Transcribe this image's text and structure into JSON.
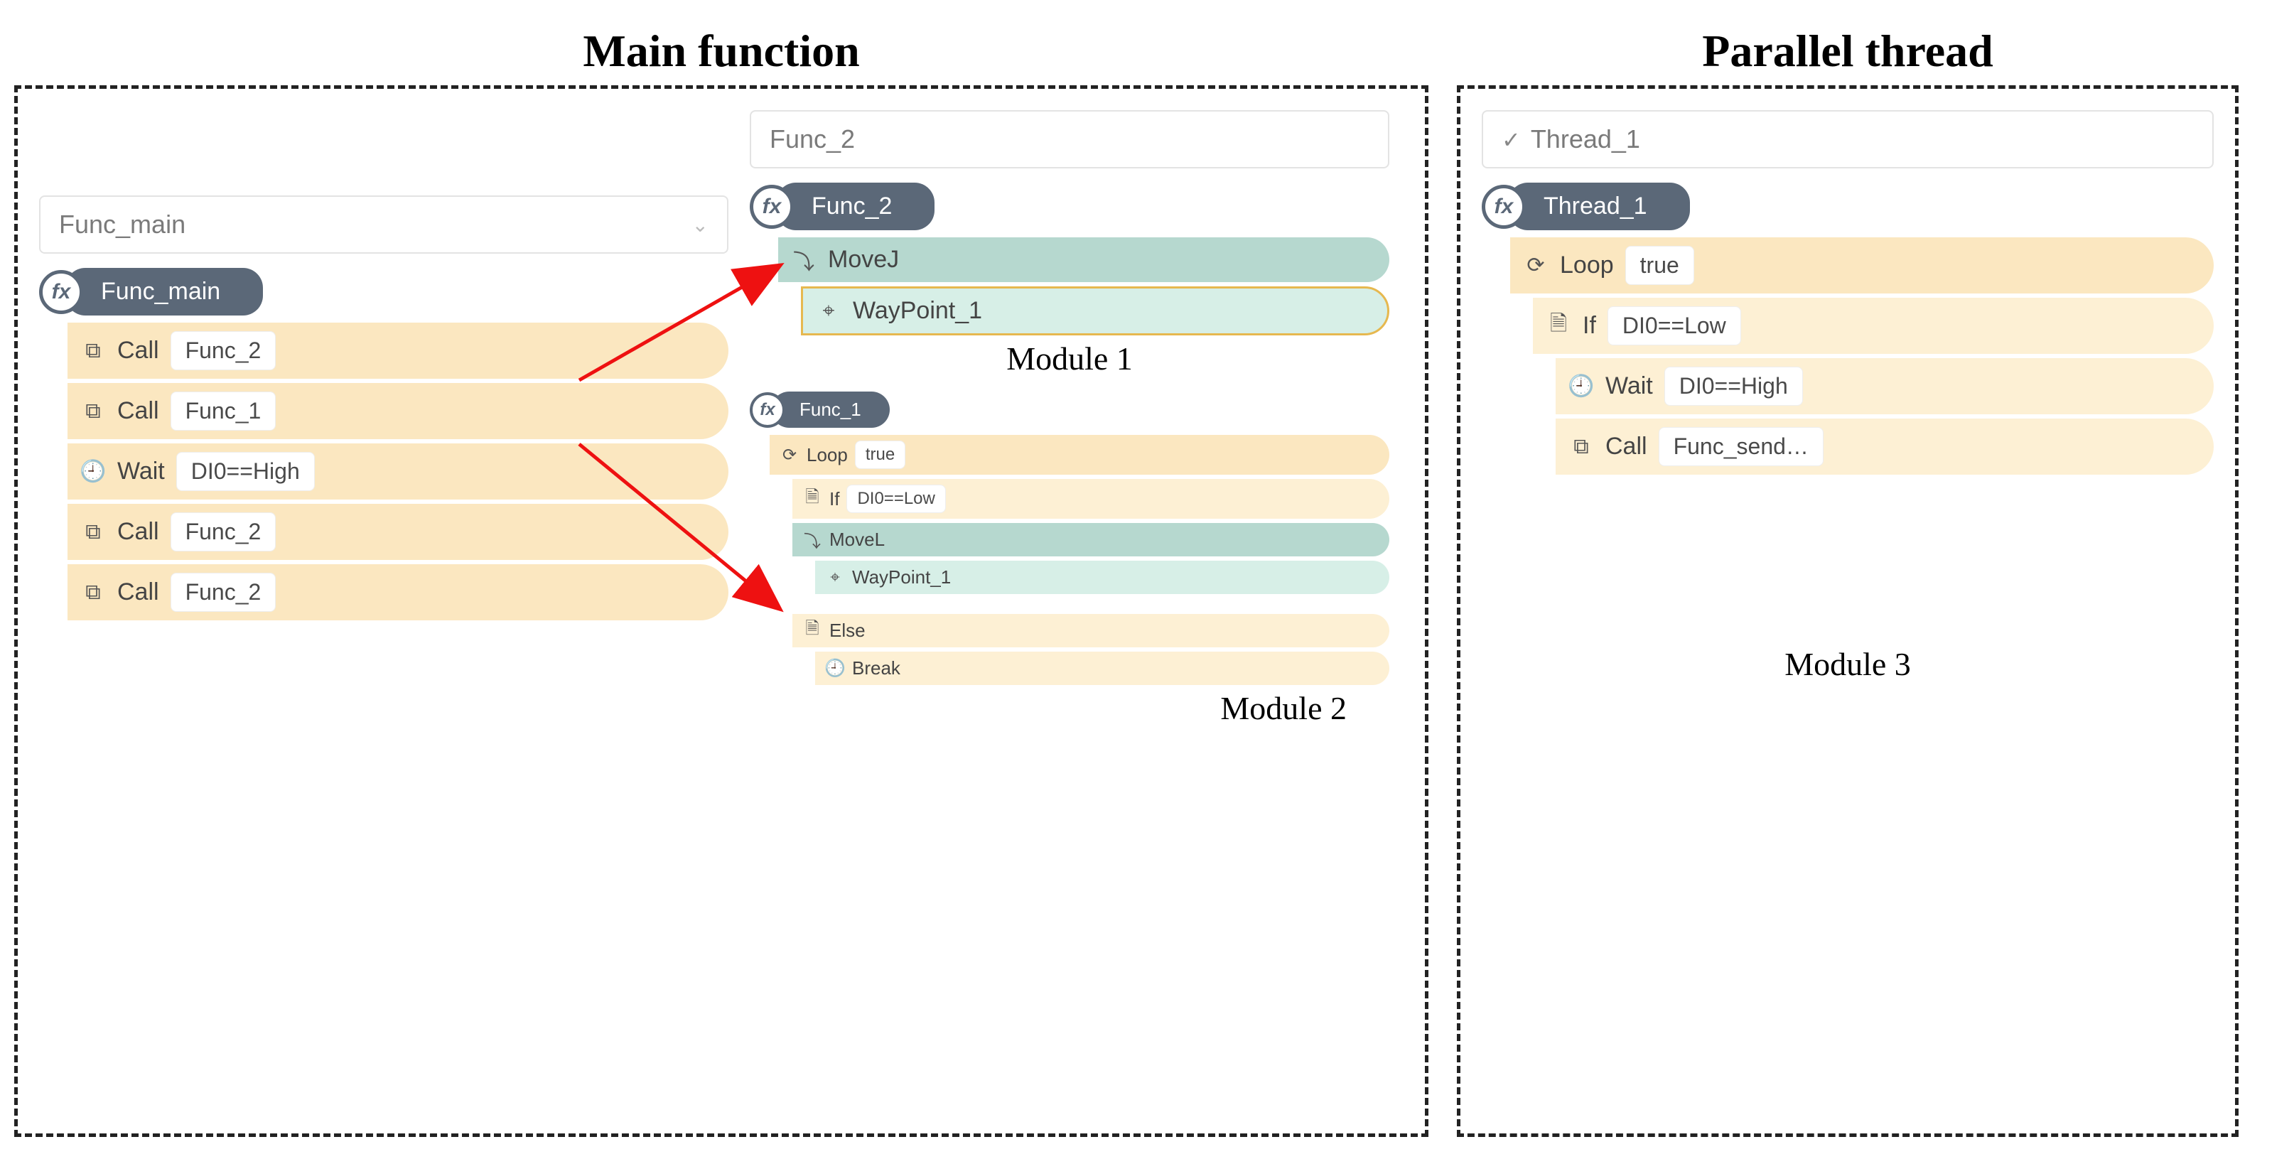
{
  "main": {
    "title": "Main function",
    "selector_label": "Func_main",
    "fx_label": "Func_main",
    "rows": [
      {
        "icon": "link-icon",
        "label": "Call",
        "pill": "Func_2"
      },
      {
        "icon": "link-icon",
        "label": "Call",
        "pill": "Func_1"
      },
      {
        "icon": "clock-icon",
        "label": "Wait",
        "pill": "DI0==High"
      },
      {
        "icon": "link-icon",
        "label": "Call",
        "pill": "Func_2"
      },
      {
        "icon": "link-icon",
        "label": "Call",
        "pill": "Func_2"
      }
    ]
  },
  "mod1": {
    "selector_label": "Func_2",
    "fx_label": "Func_2",
    "move_label": "MoveJ",
    "wp_label": "WayPoint_1",
    "caption": "Module 1"
  },
  "mod2": {
    "fx_label": "Func_1",
    "loop_label": "Loop",
    "loop_pill": "true",
    "if_label": "If",
    "if_pill": "DI0==Low",
    "move_label": "MoveL",
    "wp_label": "WayPoint_1",
    "else_label": "Else",
    "break_label": "Break",
    "caption": "Module 2"
  },
  "thread": {
    "title": "Parallel thread",
    "selector_label": "Thread_1",
    "fx_label": "Thread_1",
    "loop_label": "Loop",
    "loop_pill": "true",
    "if_label": "If",
    "if_pill": "DI0==Low",
    "wait_label": "Wait",
    "wait_pill": "DI0==High",
    "call_label": "Call",
    "call_pill": "Func_send…",
    "caption": "Module 3"
  },
  "icons": {
    "link": "⧉",
    "clock": "🕘",
    "loop": "⟳",
    "doc": "🗎",
    "pin": "📍",
    "pin2": "⌖",
    "check": "✓",
    "chev": "⌄",
    "route": "⤵"
  }
}
